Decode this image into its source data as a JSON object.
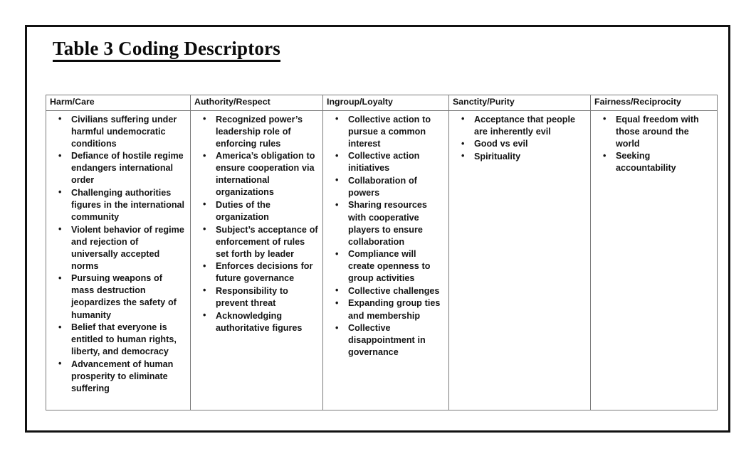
{
  "document": {
    "title": "Table 3 Coding Descriptors"
  },
  "table": {
    "columns": [
      {
        "header": "Harm/Care",
        "items": [
          "Civilians suffering under harmful undemocratic conditions",
          "Defiance of hostile regime endangers international order",
          "Challenging authorities figures in the international community",
          "Violent behavior of regime and rejection of universally accepted norms",
          "Pursuing weapons of mass destruction jeopardizes the safety of humanity",
          "Belief that everyone is entitled to human rights, liberty, and democracy",
          "Advancement of human prosperity to eliminate suffering"
        ]
      },
      {
        "header": "Authority/Respect",
        "items": [
          "Recognized power’s leadership role of enforcing rules",
          "America’s obligation to ensure cooperation via international organizations",
          "Duties of the organization",
          "Subject’s acceptance of enforcement of rules set forth by leader",
          "Enforces decisions for future governance",
          "Responsibility to prevent threat",
          "Acknowledging authoritative figures"
        ]
      },
      {
        "header": "Ingroup/Loyalty",
        "items": [
          "Collective action to pursue a common interest",
          "Collective action initiatives",
          "Collaboration of powers",
          "Sharing resources with cooperative players to ensure collaboration",
          "Compliance will create openness to group activities",
          "Collective challenges",
          "Expanding group ties and membership",
          "Collective disappointment in governance"
        ]
      },
      {
        "header": "Sanctity/Purity",
        "items": [
          "Acceptance that people are inherently evil",
          "Good vs evil",
          "Spirituality"
        ]
      },
      {
        "header": "Fairness/Reciprocity",
        "items": [
          "Equal freedom with those around the world",
          "Seeking accountability"
        ]
      }
    ]
  }
}
